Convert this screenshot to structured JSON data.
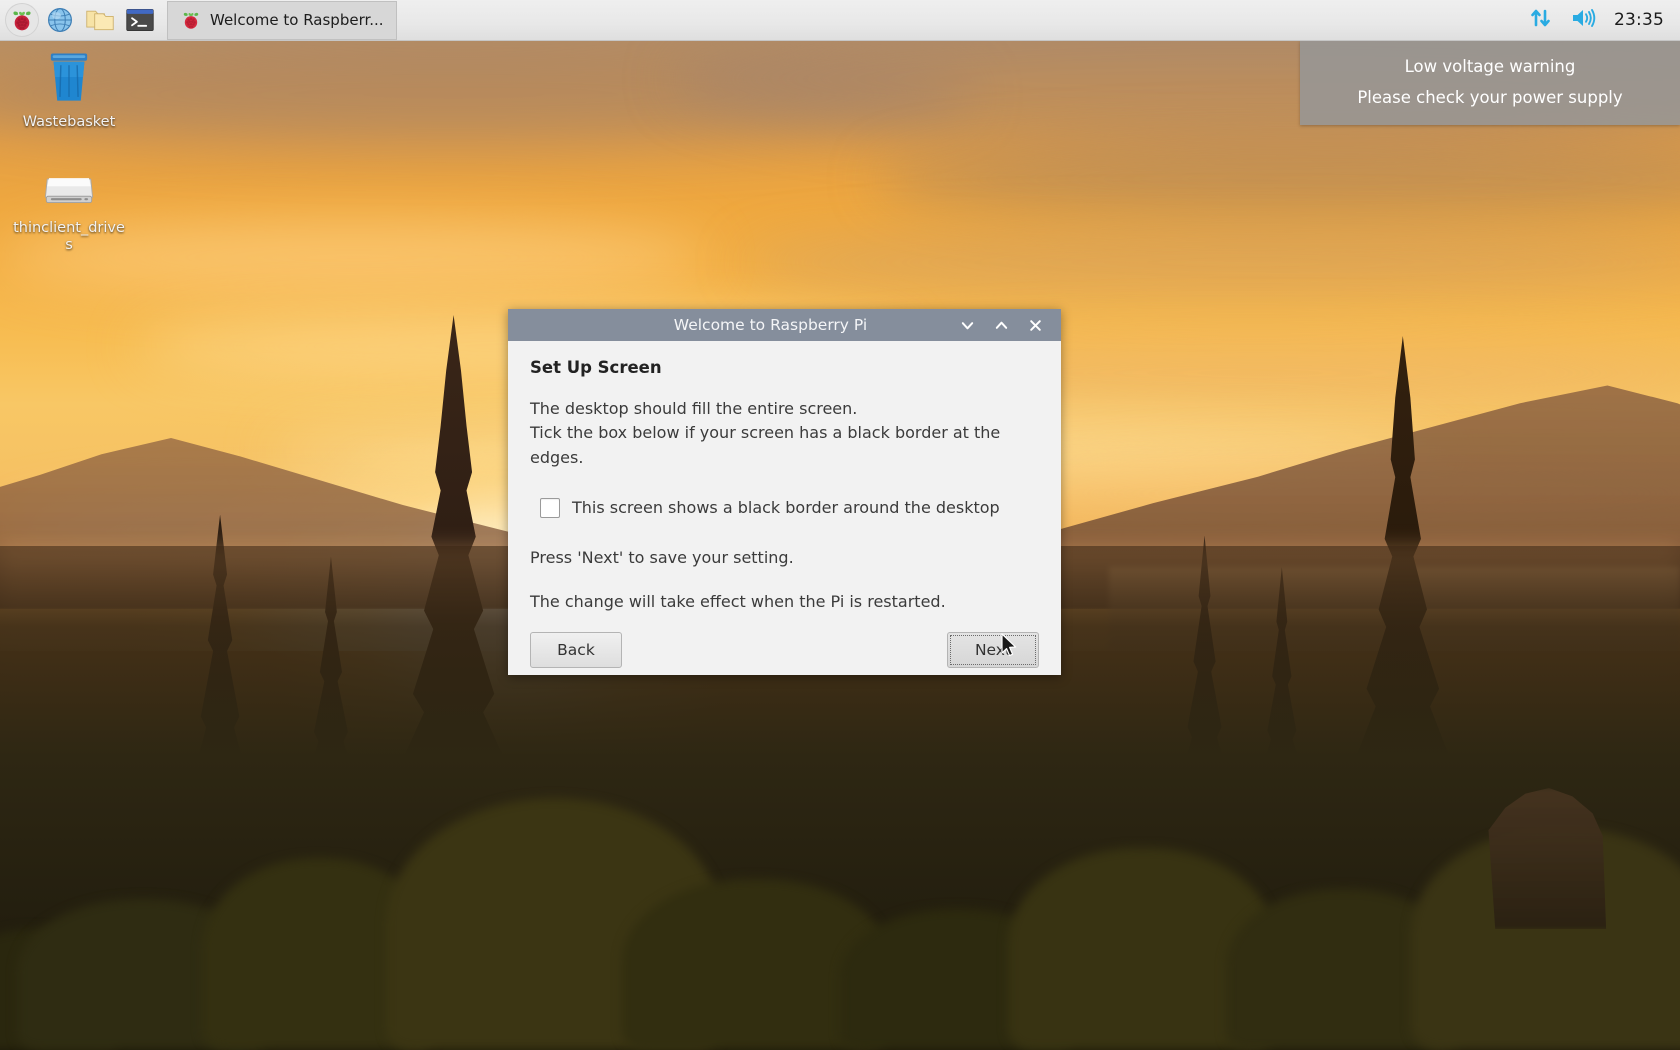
{
  "taskbar": {
    "launchers": [
      {
        "name": "raspberry-menu",
        "label": "Menu"
      },
      {
        "name": "web-browser",
        "label": "Web Browser"
      },
      {
        "name": "file-manager",
        "label": "File Manager"
      },
      {
        "name": "terminal",
        "label": "Terminal"
      }
    ],
    "active_window": {
      "label": "Welcome to Raspberr..."
    },
    "tray": {
      "network_icon": "network-updown-icon",
      "volume_icon": "volume-icon",
      "clock": "23:35"
    },
    "accent_color": "#29abe2"
  },
  "desktop": {
    "icons": [
      {
        "name": "wastebasket",
        "label": "Wastebasket",
        "icon": "trash-icon"
      },
      {
        "name": "thinclient-drives",
        "label": "thinclient_drives",
        "icon": "drive-icon"
      }
    ]
  },
  "notification": {
    "line1": "Low voltage warning",
    "line2": "Please check your power supply"
  },
  "dialog": {
    "title": "Welcome to Raspberry Pi",
    "window_buttons": {
      "minimize": "chevron-down-icon",
      "maximize": "chevron-up-icon",
      "close": "close-icon"
    },
    "heading": "Set Up Screen",
    "paragraph_line1": "The desktop should fill the entire screen.",
    "paragraph_line2": "Tick the box below if your screen has a black border at the edges.",
    "checkbox_label": "This screen shows a black border around the desktop",
    "checkbox_checked": false,
    "note1": "Press 'Next' to save your setting.",
    "note2": "The change will take effect when the Pi is restarted.",
    "back_label": "Back",
    "next_label": "Next",
    "titlebar_color": "#858e9c",
    "body_color": "#f2f2f2"
  }
}
